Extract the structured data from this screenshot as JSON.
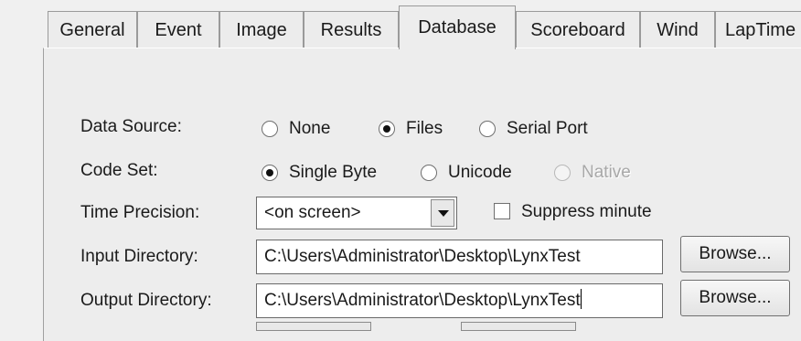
{
  "tabs": [
    {
      "label": "General",
      "active": false
    },
    {
      "label": "Event",
      "active": false
    },
    {
      "label": "Image",
      "active": false
    },
    {
      "label": "Results",
      "active": false
    },
    {
      "label": "Database",
      "active": true
    },
    {
      "label": "Scoreboard",
      "active": false
    },
    {
      "label": "Wind",
      "active": false
    },
    {
      "label": "LapTime",
      "active": false
    }
  ],
  "form": {
    "data_source": {
      "label": "Data Source:",
      "options": [
        "None",
        "Files",
        "Serial Port"
      ],
      "selected": "Files"
    },
    "code_set": {
      "label": "Code Set:",
      "options": [
        "Single Byte",
        "Unicode",
        "Native"
      ],
      "selected": "Single Byte",
      "disabled": [
        "Native"
      ]
    },
    "time_precision": {
      "label": "Time Precision:",
      "value": "<on screen>"
    },
    "suppress_minute": {
      "label": "Suppress minute",
      "checked": false
    },
    "input_directory": {
      "label": "Input Directory:",
      "value": "C:\\Users\\Administrator\\Desktop\\LynxTest",
      "browse_label": "Browse..."
    },
    "output_directory": {
      "label": "Output Directory:",
      "value": "C:\\Users\\Administrator\\Desktop\\LynxTest",
      "browse_label": "Browse..."
    }
  }
}
